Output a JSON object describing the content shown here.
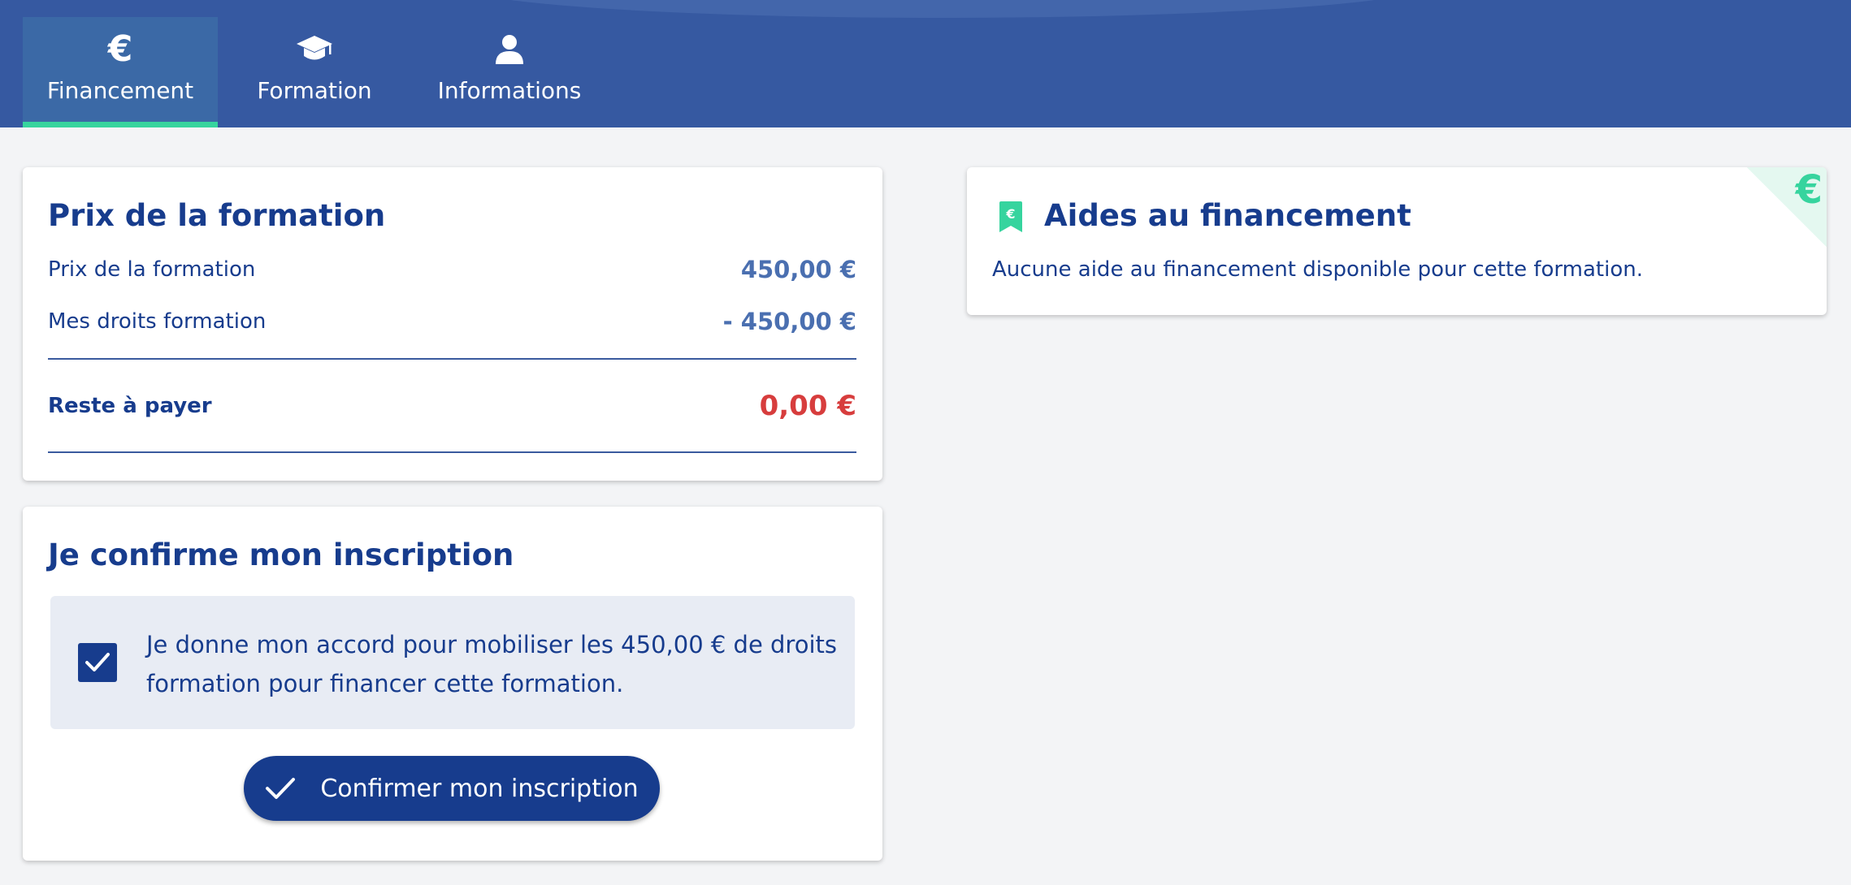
{
  "tabs": [
    {
      "label": "Financement",
      "icon": "euro-icon",
      "active": true
    },
    {
      "label": "Formation",
      "icon": "graduation-cap-icon",
      "active": false
    },
    {
      "label": "Informations",
      "icon": "user-icon",
      "active": false
    }
  ],
  "price_card": {
    "title": "Prix de la formation",
    "rows": [
      {
        "label": "Prix de la formation",
        "value": "450,00 €"
      },
      {
        "label": "Mes droits formation",
        "value": "- 450,00 €"
      }
    ],
    "total": {
      "label": "Reste à payer",
      "value": "0,00 €"
    }
  },
  "confirm_card": {
    "title": "Je confirme mon inscription",
    "consent_text": "Je donne mon accord pour mobiliser les 450,00 € de droits formation pour financer cette formation.",
    "consent_checked": true,
    "button_label": "Confirmer mon inscription"
  },
  "aid_card": {
    "title": "Aides au financement",
    "text": "Aucune aide au financement disponible pour cette formation.",
    "corner_icon": "euro-icon",
    "title_icon": "euro-bookmark-icon"
  },
  "colors": {
    "header_bg": "#3659a1",
    "active_tab_bg": "#3b69a6",
    "accent_green": "#36d49e",
    "primary": "#173c8d",
    "amount_blue": "#4a6fb0",
    "amount_red": "#d73d3d"
  }
}
